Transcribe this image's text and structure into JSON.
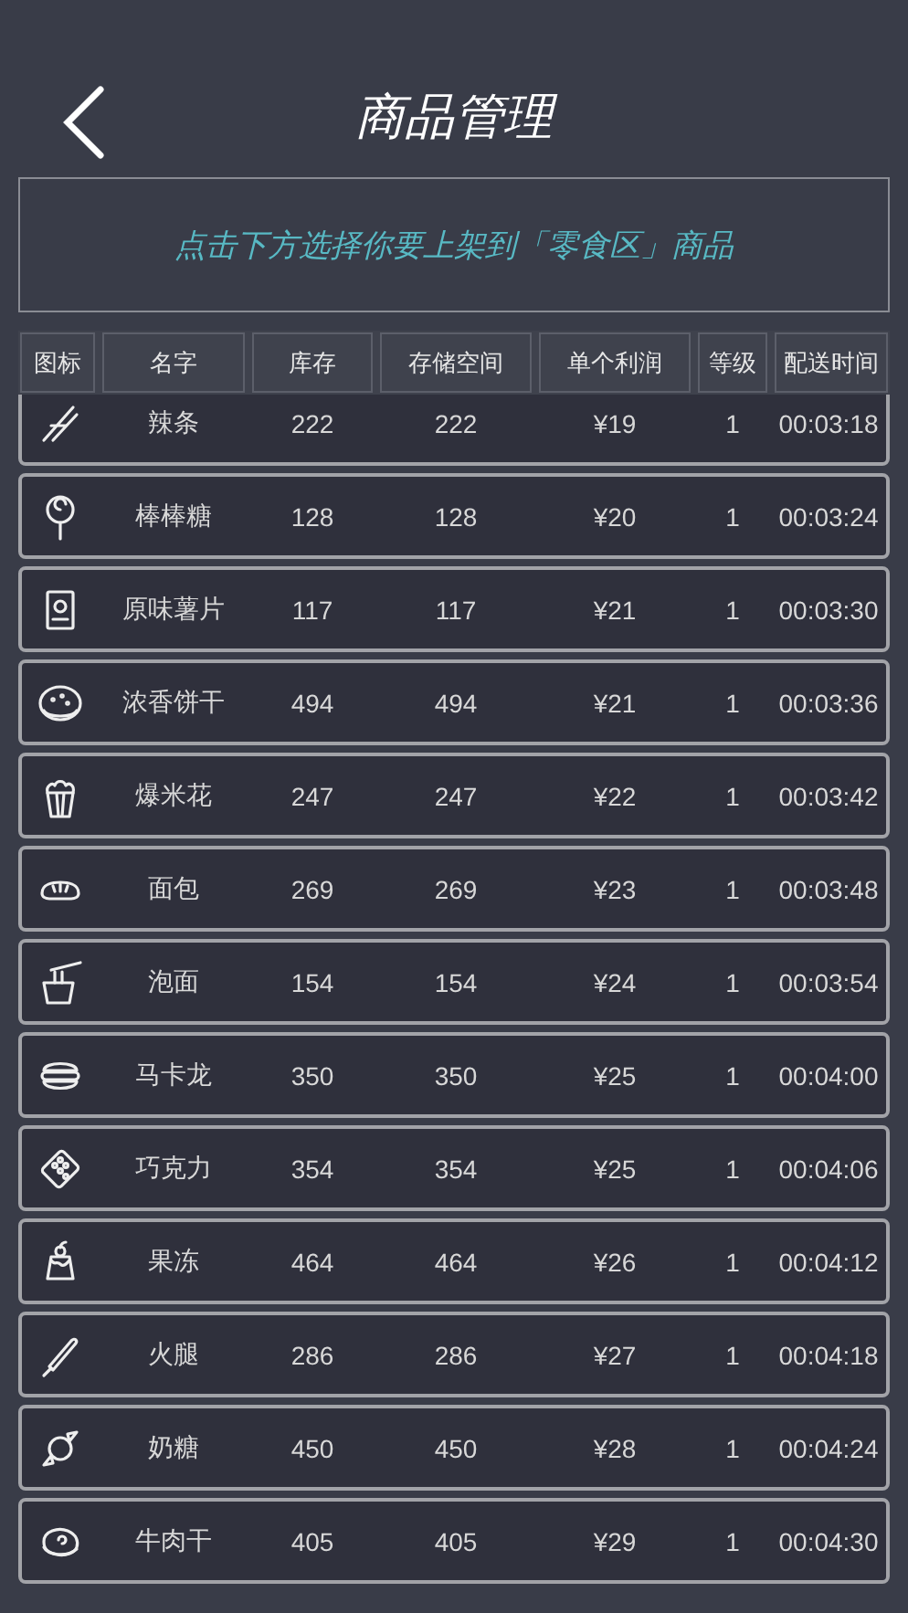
{
  "header": {
    "title": "商品管理"
  },
  "banner": {
    "text": "点击下方选择你要上架到「零食区」商品"
  },
  "table": {
    "columns": [
      "图标",
      "名字",
      "库存",
      "存储空间",
      "单个利润",
      "等级",
      "配送时间"
    ],
    "rows": [
      {
        "name": "辣条",
        "stock": "222",
        "storage": "222",
        "profit": "¥19",
        "level": "1",
        "time": "00:03:18"
      },
      {
        "name": "棒棒糖",
        "stock": "128",
        "storage": "128",
        "profit": "¥20",
        "level": "1",
        "time": "00:03:24"
      },
      {
        "name": "原味薯片",
        "stock": "117",
        "storage": "117",
        "profit": "¥21",
        "level": "1",
        "time": "00:03:30"
      },
      {
        "name": "浓香饼干",
        "stock": "494",
        "storage": "494",
        "profit": "¥21",
        "level": "1",
        "time": "00:03:36"
      },
      {
        "name": "爆米花",
        "stock": "247",
        "storage": "247",
        "profit": "¥22",
        "level": "1",
        "time": "00:03:42"
      },
      {
        "name": "面包",
        "stock": "269",
        "storage": "269",
        "profit": "¥23",
        "level": "1",
        "time": "00:03:48"
      },
      {
        "name": "泡面",
        "stock": "154",
        "storage": "154",
        "profit": "¥24",
        "level": "1",
        "time": "00:03:54"
      },
      {
        "name": "马卡龙",
        "stock": "350",
        "storage": "350",
        "profit": "¥25",
        "level": "1",
        "time": "00:04:00"
      },
      {
        "name": "巧克力",
        "stock": "354",
        "storage": "354",
        "profit": "¥25",
        "level": "1",
        "time": "00:04:06"
      },
      {
        "name": "果冻",
        "stock": "464",
        "storage": "464",
        "profit": "¥26",
        "level": "1",
        "time": "00:04:12"
      },
      {
        "name": "火腿",
        "stock": "286",
        "storage": "286",
        "profit": "¥27",
        "level": "1",
        "time": "00:04:18"
      },
      {
        "name": "奶糖",
        "stock": "450",
        "storage": "450",
        "profit": "¥28",
        "level": "1",
        "time": "00:04:24"
      },
      {
        "name": "牛肉干",
        "stock": "405",
        "storage": "405",
        "profit": "¥29",
        "level": "1",
        "time": "00:04:30"
      }
    ]
  }
}
